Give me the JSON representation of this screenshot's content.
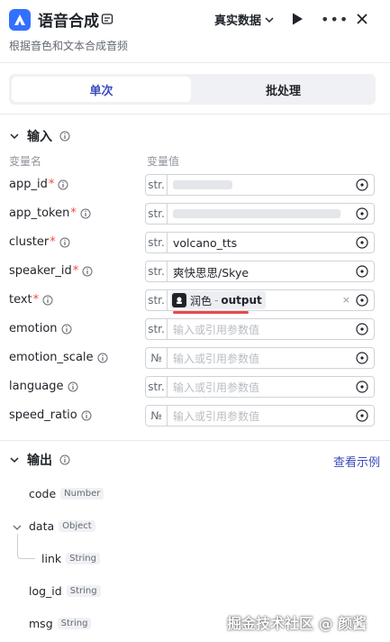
{
  "header": {
    "title": "语音合成",
    "subtitle": "根据音色和文本合成音频",
    "mode": "真实数据",
    "icons": {
      "logo": "app-logo-icon",
      "title": "card-icon",
      "run": "play-icon",
      "more": "more-icon",
      "close": "close-icon"
    },
    "accent": "#3370ff"
  },
  "tabs": [
    {
      "label": "单次",
      "active": true
    },
    {
      "label": "批处理",
      "active": false
    }
  ],
  "input": {
    "title": "输入",
    "col_name": "变量名",
    "col_value": "变量值",
    "placeholder": "输入或引用参数值",
    "rows": [
      {
        "name": "app_id",
        "required": true,
        "type": "str.",
        "value": ""
      },
      {
        "name": "app_token",
        "required": true,
        "type": "str.",
        "value": ""
      },
      {
        "name": "cluster",
        "required": true,
        "type": "str.",
        "value": "volcano_tts"
      },
      {
        "name": "speaker_id",
        "required": true,
        "type": "str.",
        "value": "爽快思思/Skye"
      },
      {
        "name": "text",
        "required": true,
        "type": "str.",
        "ref_node": "润色",
        "ref_sep": "-",
        "ref_output": "output",
        "ref_clear": "×"
      },
      {
        "name": "emotion",
        "required": false,
        "type": "str."
      },
      {
        "name": "emotion_scale",
        "required": false,
        "type": "№"
      },
      {
        "name": "language",
        "required": false,
        "type": "str."
      },
      {
        "name": "speed_ratio",
        "required": false,
        "type": "№"
      }
    ]
  },
  "output": {
    "title": "输出",
    "view_example": "查看示例",
    "fields": [
      {
        "name": "code",
        "type": "Number"
      },
      {
        "name": "data",
        "type": "Object"
      },
      {
        "name": "link",
        "type": "String"
      },
      {
        "name": "log_id",
        "type": "String"
      },
      {
        "name": "msg",
        "type": "String"
      }
    ]
  },
  "watermark": "掘金技术社区 @ 颜酱",
  "colors": {
    "required": "#f54a45",
    "link": "#3b4bbd",
    "highlight": "#e8484e"
  }
}
